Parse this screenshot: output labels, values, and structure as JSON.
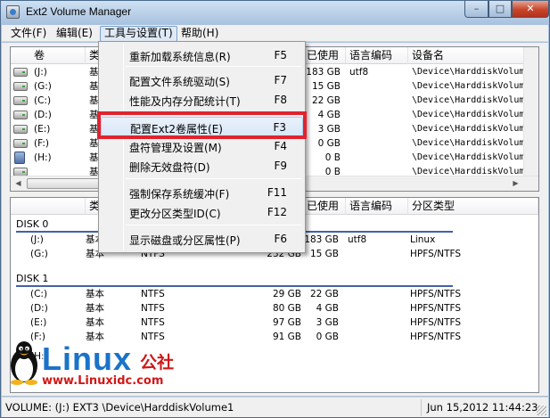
{
  "window": {
    "title": "Ext2 Volume Manager",
    "minimize_glyph": "–",
    "maximize_glyph": "□",
    "close_glyph": "✕"
  },
  "menubar": {
    "file": "文件(F)",
    "edit": "编辑(E)",
    "tools": "工具与设置(T)",
    "help": "帮助(H)"
  },
  "tools_menu": {
    "items": [
      {
        "label": "重新加载系统信息(R)",
        "key": "F5"
      },
      {
        "label": "配置文件系统驱动(S)",
        "key": "F7"
      },
      {
        "label": "性能及内存分配统计(T)",
        "key": "F8"
      },
      {
        "label": "配置Ext2卷属性(E)",
        "key": "F3"
      },
      {
        "label": "盘符管理及设置(M)",
        "key": "F4"
      },
      {
        "label": "删除无效盘符(D)",
        "key": "F9"
      },
      {
        "label": "强制保存系统缓冲(F)",
        "key": "F11"
      },
      {
        "label": "更改分区类型ID(C)",
        "key": "F12"
      },
      {
        "label": "显示磁盘或分区属性(P)",
        "key": "F6"
      }
    ]
  },
  "volumes_table": {
    "headers": {
      "volume": "卷",
      "type": "类",
      "used": "已使用",
      "codepage": "语言编码",
      "device": "设备名"
    },
    "rows": [
      {
        "volume": "(J:)",
        "type": "基",
        "used": "183 GB",
        "codepage": "utf8",
        "device": "\\Device\\HarddiskVolum"
      },
      {
        "volume": "(G:)",
        "type": "基",
        "used": "15 GB",
        "codepage": "",
        "device": "\\Device\\HarddiskVolum"
      },
      {
        "volume": "(C:)",
        "type": "基",
        "used": "22 GB",
        "codepage": "",
        "device": "\\Device\\HarddiskVolum"
      },
      {
        "volume": "(D:)",
        "type": "基",
        "used": "4 GB",
        "codepage": "",
        "device": "\\Device\\HarddiskVolum"
      },
      {
        "volume": "(E:)",
        "type": "基",
        "used": "3 GB",
        "codepage": "",
        "device": "\\Device\\HarddiskVolum"
      },
      {
        "volume": "(F:)",
        "type": "基",
        "used": "0 GB",
        "codepage": "",
        "device": "\\Device\\HarddiskVolum"
      },
      {
        "volume": "(H:)",
        "type": "基",
        "used": "0 B",
        "codepage": "",
        "device": "\\Device\\HarddiskVolum"
      },
      {
        "volume": "",
        "type": "基",
        "used": "0 B",
        "codepage": "",
        "device": "\\Device\\HarddiskVolum"
      }
    ]
  },
  "disks_table": {
    "headers": {
      "type": "类",
      "used": "已使用",
      "codepage": "语言编码",
      "parttype": "分区类型"
    },
    "disks": [
      {
        "name": "DISK 0",
        "partitions": [
          {
            "volume": "(J:)",
            "type": "基本",
            "fs": "EXT3",
            "size": "",
            "used": "183 GB",
            "codepage": "utf8",
            "parttype": "Linux"
          },
          {
            "volume": "(G:)",
            "type": "基本",
            "fs": "NTFS",
            "size": "232 GB",
            "used": "15 GB",
            "codepage": "",
            "parttype": "HPFS/NTFS"
          }
        ]
      },
      {
        "name": "DISK 1",
        "partitions": [
          {
            "volume": "(C:)",
            "type": "基本",
            "fs": "NTFS",
            "size": "29 GB",
            "used": "22 GB",
            "codepage": "",
            "parttype": "HPFS/NTFS"
          },
          {
            "volume": "(D:)",
            "type": "基本",
            "fs": "NTFS",
            "size": "80 GB",
            "used": "4 GB",
            "codepage": "",
            "parttype": "HPFS/NTFS"
          },
          {
            "volume": "(E:)",
            "type": "基本",
            "fs": "NTFS",
            "size": "97 GB",
            "used": "3 GB",
            "codepage": "",
            "parttype": "HPFS/NTFS"
          },
          {
            "volume": "(F:)",
            "type": "基本",
            "fs": "NTFS",
            "size": "91 GB",
            "used": "0 GB",
            "codepage": "",
            "parttype": "HPFS/NTFS"
          }
        ]
      }
    ],
    "partial_row_volume": "(H:)"
  },
  "watermark": {
    "brand": "Linux",
    "brand_cn": "公社",
    "url": "www.Linuxidc.com"
  },
  "statusbar": {
    "volume_info": "VOLUME: (J:) EXT3 \\Device\\HarddiskVolume1",
    "datetime": "Jun 15,2012 11:44:23"
  },
  "colors": {
    "highlight_box": "#e1232e",
    "disk_line": "#4261a8",
    "watermark_blue": "#1a73c9",
    "watermark_red": "#d01818"
  }
}
